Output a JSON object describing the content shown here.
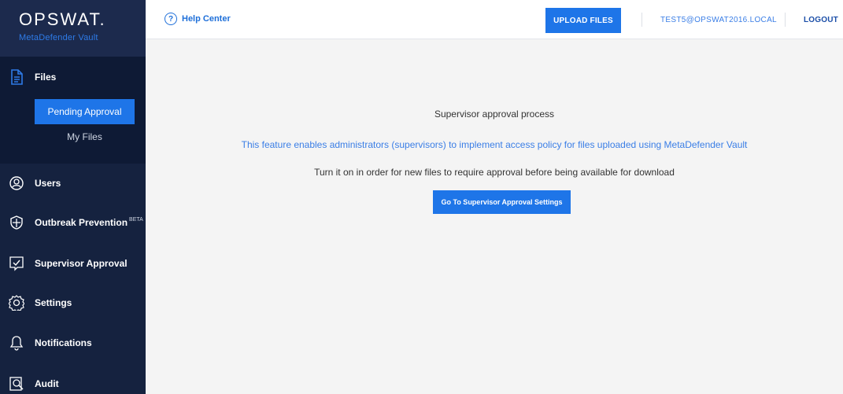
{
  "brand": {
    "logo": "OPSWAT.",
    "product": "MetaDefender Vault"
  },
  "topbar": {
    "help_label": "Help Center",
    "help_icon": "?",
    "upload_label": "UPLOAD FILES",
    "user": "TEST5@OPSWAT2016.LOCAL",
    "logout": "LOGOUT"
  },
  "sidebar": {
    "files": {
      "label": "Files",
      "icon": "file-icon"
    },
    "sub_items": [
      {
        "label": "Pending Approval",
        "active": true
      },
      {
        "label": "My Files",
        "active": false
      }
    ],
    "items": [
      {
        "label": "Users",
        "icon": "users-icon"
      },
      {
        "label": "Outbreak Prevention",
        "badge": "BETA",
        "icon": "shield-icon"
      },
      {
        "label": "Supervisor Approval",
        "icon": "approval-icon"
      },
      {
        "label": "Settings",
        "icon": "gear-icon"
      },
      {
        "label": "Notifications",
        "icon": "bell-icon"
      },
      {
        "label": "Audit",
        "icon": "audit-icon"
      }
    ]
  },
  "main": {
    "title": "Supervisor approval process",
    "description": "This feature enables administrators (supervisors) to implement access policy for files uploaded using MetaDefender Vault",
    "note": "Turn it on in order for new files to require approval before being available for download",
    "button_label": "Go To Supervisor Approval Settings"
  },
  "colors": {
    "sidebar": "#15223f",
    "accent": "#1e75e8",
    "link": "#3a7ee6"
  }
}
